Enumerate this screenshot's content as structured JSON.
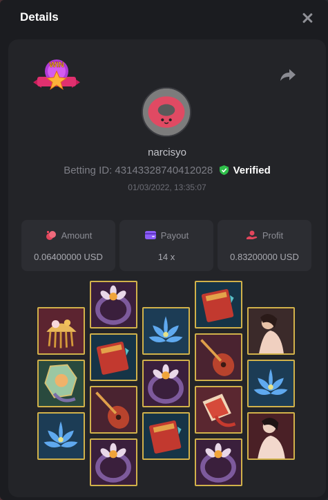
{
  "header": {
    "title": "Details"
  },
  "player": {
    "username": "narcisyo"
  },
  "bet": {
    "id_label": "Betting ID:",
    "id_value": "43143328740412028",
    "verified_label": "Verified",
    "datetime": "01/03/2022, 13:35:07"
  },
  "stats": {
    "amount": {
      "label": "Amount",
      "value": "0.06400000 USD"
    },
    "payout": {
      "label": "Payout",
      "value": "14 x"
    },
    "profit": {
      "label": "Profit",
      "value": "0.83200000 USD"
    }
  },
  "colors": {
    "accent_gold": "#d2b24a",
    "verified_green": "#2fbf4a",
    "icon_pink": "#e3465c",
    "icon_purple": "#8b5cf6"
  },
  "reels": [
    [
      "comb",
      "jade-mirror",
      "blue-lotus"
    ],
    [
      "ring",
      "red-book",
      "pipa-lute",
      "ring"
    ],
    [
      "blue-lotus",
      "ring",
      "red-book"
    ],
    [
      "red-book",
      "pipa-lute",
      "fan",
      "ring"
    ],
    [
      "lady",
      "blue-lotus",
      "lady"
    ]
  ]
}
